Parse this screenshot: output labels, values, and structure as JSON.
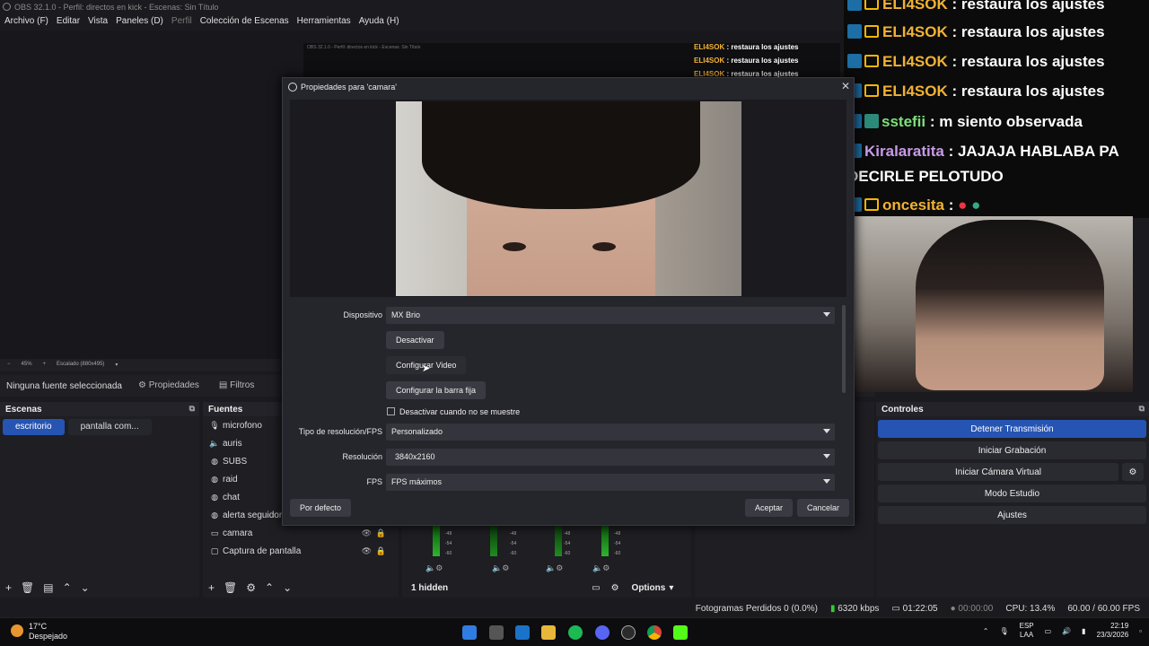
{
  "window": {
    "title": "OBS 32.1.0 - Perfil: directos en kick - Escenas: Sin Título"
  },
  "menu": [
    "Archivo (F)",
    "Editar",
    "Vista",
    "Paneles (D)",
    "Perfil",
    "Colección de Escenas",
    "Herramientas",
    "Ayuda (H)"
  ],
  "zoom": {
    "level": "45%",
    "scale": "Escalado (880x495)"
  },
  "source_toolbar": {
    "no_source": "Ninguna fuente seleccionada",
    "properties": "Propiedades",
    "filters": "Filtros"
  },
  "scenes": {
    "title": "Escenas",
    "items": [
      "escritorio",
      "pantalla com..."
    ]
  },
  "sources": {
    "title": "Fuentes",
    "items": [
      "microfono",
      "auris",
      "SUBS",
      "raid",
      "chat",
      "alerta seguidores",
      "camara",
      "Captura de pantalla"
    ]
  },
  "mixer": {
    "labels": [
      "-48",
      "-54",
      "-60"
    ],
    "hidden": "1 hidden",
    "options": "Options"
  },
  "controls": {
    "title": "Controles",
    "buttons": [
      "Detener Transmisión",
      "Iniciar Grabación",
      "Iniciar Cámara Virtual",
      "Modo Estudio",
      "Ajustes"
    ]
  },
  "status": {
    "frames": "Fotogramas Perdidos 0 (0.0%)",
    "kbps": "6320 kbps",
    "stream_time": "01:22:05",
    "rec_time": "00:00:00",
    "cpu": "CPU: 13.4%",
    "fps": "60.00 / 60.00 FPS"
  },
  "taskbar": {
    "temp": "17°C",
    "weather": "Despejado",
    "lang1": "ESP",
    "lang2": "LAA",
    "time": "22:19",
    "date": "23/3/2026"
  },
  "chat": [
    {
      "user": "ELI4SOK",
      "msg": ": restaura los ajustes",
      "color": "#f2b233"
    },
    {
      "user": "ELI4SOK",
      "msg": ": restaura los ajustes",
      "color": "#f2b233"
    },
    {
      "user": "ELI4SOK",
      "msg": ": restaura los ajustes",
      "color": "#f2b233"
    },
    {
      "user": "ELI4SOK",
      "msg": ": restaura los ajustes",
      "color": "#f2b233"
    },
    {
      "user": "sstefii",
      "msg": ": m siento observada",
      "color": "#7de07a"
    },
    {
      "user": "Kiralaratita",
      "msg": ": JAJAJA HABLABA PA",
      "color": "#c89be8"
    },
    {
      "user": "",
      "msg": "DECIRLE PELOTUDO",
      "color": "#ffffff"
    },
    {
      "user": "oncesita",
      "msg": ":",
      "color": "#f2b233"
    }
  ],
  "mini_chat": [
    {
      "user": "ELI4SOK",
      "msg": ": restaura los ajustes"
    },
    {
      "user": "ELI4SOK",
      "msg": ": restaura los ajustes"
    },
    {
      "user": "ELI4SOK",
      "msg": ": restaura los ajustes"
    }
  ],
  "dialog": {
    "title": "Propiedades para 'camara'",
    "device_label": "Dispositivo",
    "device": "MX Brio",
    "deactivate": "Desactivar",
    "configure_video": "Configurar Video",
    "configure_bar": "Configurar la barra fija",
    "checkbox": "Desactivar cuando no se muestre",
    "res_type_label": "Tipo de resolución/FPS",
    "res_type": "Personalizado",
    "resolution_label": "Resolución",
    "resolution": "3840x2160",
    "fps_label": "FPS",
    "fps": "FPS máximos",
    "defaults": "Por defecto",
    "accept": "Aceptar",
    "cancel": "Cancelar"
  }
}
